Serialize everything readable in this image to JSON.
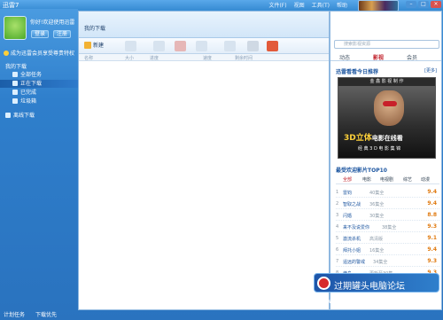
{
  "app": {
    "title": "迅雷7"
  },
  "menu": [
    "文件(F)",
    "视图",
    "工具(T)",
    "帮助"
  ],
  "user": {
    "name": "你好!欢迎使用迅雷",
    "login": "登录",
    "register": "注册",
    "vip": "成为迅雷会员享受尊贵特权"
  },
  "nav": {
    "head": "我的下载",
    "items": [
      {
        "label": "全部任务"
      },
      {
        "label": "正在下载"
      },
      {
        "label": "已完成"
      },
      {
        "label": "垃圾箱"
      },
      {
        "label": "离线下载"
      }
    ]
  },
  "status": {
    "plan": "计划任务",
    "speed": "下载优先"
  },
  "center": {
    "tab": "我的下载",
    "new_label": "新建",
    "columns": [
      "名称",
      "大小",
      "进度",
      "速度",
      "剩余时间"
    ]
  },
  "right": {
    "search_placeholder": "搜索影视资源",
    "tabs": [
      "动态",
      "影视",
      "会员"
    ],
    "rec_title": "迅雷看看今日推荐",
    "rec_more": "[更多]",
    "poster": {
      "head": "金 鑫 影 视 制 作",
      "title": "3D立体",
      "title2": "电影在线看",
      "sub": "经 典 3 D 电 影 集 锦"
    },
    "top10_title": "最受欢迎影片TOP10",
    "cats": [
      "全部",
      "电影",
      "电视剧",
      "综艺",
      "动漫"
    ],
    "ranks": [
      {
        "num": "1",
        "name": "雷钧",
        "meta": "40集全",
        "score": "9.4"
      },
      {
        "num": "2",
        "name": "智取之战",
        "meta": "36集全",
        "score": "9.4"
      },
      {
        "num": "3",
        "name": "闪婚",
        "meta": "30集全",
        "score": "8.8"
      },
      {
        "num": "4",
        "name": "来不及说爱你",
        "meta": "38集全",
        "score": "9.3"
      },
      {
        "num": "5",
        "name": "激流杀机",
        "meta": "高清版",
        "score": "9.1"
      },
      {
        "num": "6",
        "name": "拜托小姐",
        "meta": "16集全",
        "score": "9.4"
      },
      {
        "num": "7",
        "name": "遥远的警戒",
        "meta": "34集全",
        "score": "9.3"
      },
      {
        "num": "8",
        "name": "蜂鸟",
        "meta": "更新至30集",
        "score": "9.3"
      }
    ]
  },
  "watermark": {
    "text": "过期罐头电脑论坛",
    "url": "www.gqgtpc.com"
  }
}
